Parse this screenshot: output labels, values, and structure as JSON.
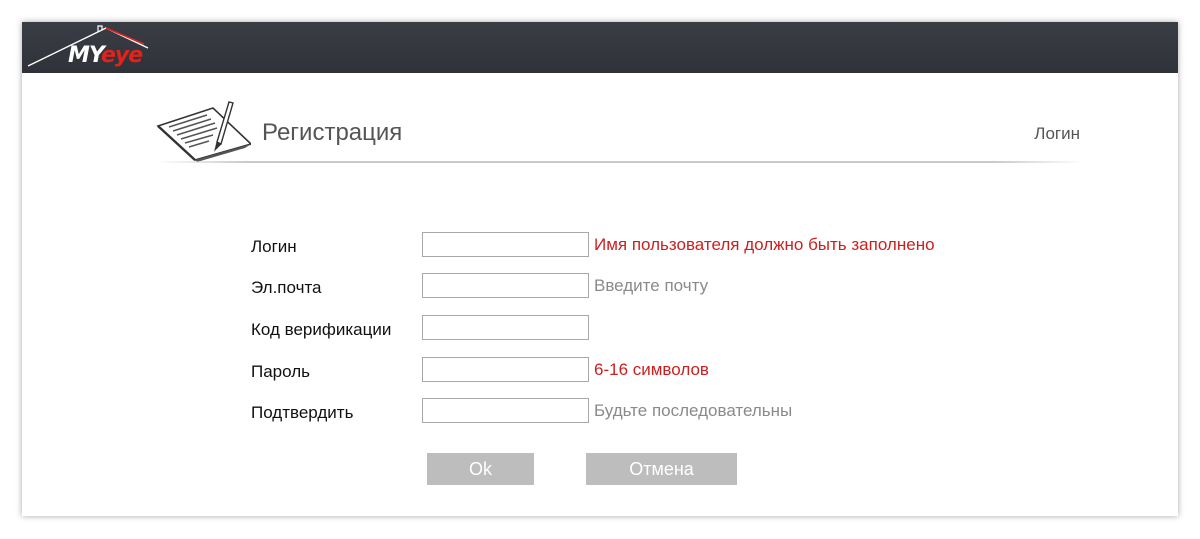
{
  "brand": {
    "logo_main": "MY",
    "logo_accent": "eye"
  },
  "header": {
    "title": "Регистрация",
    "login_link": "Логин"
  },
  "form": {
    "fields": [
      {
        "label": "Логин",
        "value": "",
        "hint": "Имя пользователя должно быть заполнено",
        "hint_type": "error"
      },
      {
        "label": "Эл.почта",
        "value": "",
        "hint": "Введите почту",
        "hint_type": "info"
      },
      {
        "label": "Код верификации",
        "value": "",
        "hint": "",
        "hint_type": "info"
      },
      {
        "label": "Пароль",
        "value": "",
        "hint": "6-16 символов",
        "hint_type": "error"
      },
      {
        "label": "Подтвердить",
        "value": "",
        "hint": "Будьте последовательны",
        "hint_type": "info"
      }
    ]
  },
  "buttons": {
    "ok": "Ok",
    "cancel": "Отмена"
  },
  "colors": {
    "topbar": "#34373e",
    "error_text": "#cc1f1f",
    "hint_text": "#8a8a8a",
    "button_bg": "#bdbdbd",
    "logo_accent": "#e1231b"
  },
  "icons": {
    "logo_roof": "house-roof-icon",
    "registration": "document-pen-icon"
  }
}
